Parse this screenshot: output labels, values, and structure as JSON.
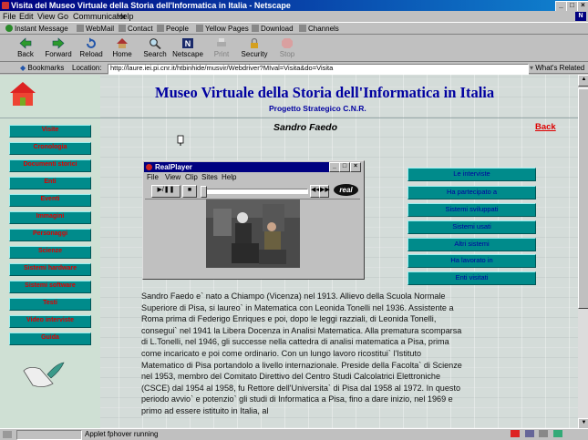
{
  "window": {
    "title": "Visita del Museo Virtuale della Storia dell'Informatica in Italia - Netscape",
    "controls": [
      "_",
      "□",
      "×"
    ]
  },
  "menubar": [
    "File",
    "Edit",
    "View",
    "Go",
    "Communicator",
    "Help"
  ],
  "personal_toolbar": [
    "Instant Message",
    "WebMail",
    "Contact",
    "People",
    "Yellow Pages",
    "Download",
    "Channels"
  ],
  "nav_toolbar": [
    {
      "label": "Back",
      "icon": "back-arrow-icon"
    },
    {
      "label": "Forward",
      "icon": "forward-arrow-icon"
    },
    {
      "label": "Reload",
      "icon": "reload-icon"
    },
    {
      "label": "Home",
      "icon": "home-icon"
    },
    {
      "label": "Search",
      "icon": "search-icon"
    },
    {
      "label": "Netscape",
      "icon": "netscape-icon"
    },
    {
      "label": "Print",
      "icon": "print-icon"
    },
    {
      "label": "Security",
      "icon": "security-lock-icon"
    },
    {
      "label": "Stop",
      "icon": "stop-icon"
    }
  ],
  "location_bar": {
    "bookmarks_label": "Bookmarks",
    "location_label": "Location:",
    "url": "http://laure.iei.pi.cnr.it/htbinhide/musvir/Webdriver?MIval=Visita&do=Visita",
    "related_label": "What's Related"
  },
  "page": {
    "title": "Museo Virtuale della Storia dell'Informatica in Italia",
    "subtitle": "Progetto Strategico C.N.R.",
    "person": "Sandro Faedo",
    "back_link": "Back",
    "left_nav": [
      "Visite",
      "Cronologia",
      "Documenti storici",
      "Enti",
      "Eventi",
      "Immagini",
      "Personaggi",
      "Scienze",
      "Sistemi hardware",
      "Sistemi software",
      "Testi",
      "Video interviste",
      "Guida"
    ],
    "right_nav": [
      "Le interviste",
      "Ha partecipato a",
      "Sistemi sviluppati",
      "Sistemi usati",
      "Altri sistemi",
      "Ha lavorato in",
      "Enti visitati"
    ],
    "biography": "Sandro Faedo e` nato a Chiampo (Vicenza) nel 1913. Allievo della Scuola Normale Superiore di Pisa, si laureo` in Matematica con Leonida Tonelli nel 1936. Assistente a Roma prima di Federigo Enriques e poi, dopo le leggi razziali, di Leonida Tonelli, consegui` nel 1941 la Libera Docenza in Analisi Matematica. Alla prematura scomparsa di L.Tonelli, nel 1946, gli successe nella cattedra di analisi matematica a Pisa, prima come incaricato e poi come ordinario. Con un lungo lavoro ricostitui` l'Istituto Matematico di Pisa portandolo a livello internazionale. Preside della Facolta` di Scienze nel 1953, membro del Comitato Direttivo del Centro Studi Calcolatrici Elettroniche (CSCE) dal 1954 al 1958, fu Rettore dell'Universita` di Pisa dal 1958 al 1972. In questo periodo avvio` e potenzio` gli studi di Informatica a Pisa, fino a dare inizio, nel 1969 e primo ad essere istituito in Italia, al"
  },
  "realplayer": {
    "title": "RealPlayer",
    "menu": [
      "File",
      "View",
      "Clip",
      "Sites",
      "Help"
    ],
    "play_label": "▶/❚❚",
    "stop_label": "■",
    "brand": "real"
  },
  "status": {
    "text": "Applet fphover running"
  },
  "colors": {
    "nav_button_bg": "#008b8b",
    "left_nav_text": "#dd0000",
    "right_nav_text": "#0000a0",
    "title_color": "#0000a0"
  }
}
